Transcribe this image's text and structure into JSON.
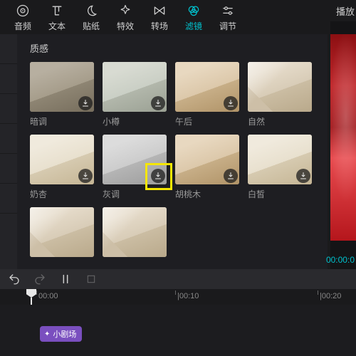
{
  "tabs": [
    {
      "id": "audio",
      "label": "音频"
    },
    {
      "id": "text",
      "label": "文本"
    },
    {
      "id": "sticker",
      "label": "贴纸"
    },
    {
      "id": "effect",
      "label": "特效"
    },
    {
      "id": "transition",
      "label": "转场"
    },
    {
      "id": "filter",
      "label": "滤镜",
      "active": true
    },
    {
      "id": "adjust",
      "label": "调节"
    }
  ],
  "section": {
    "title": "质感"
  },
  "filters": [
    {
      "id": "dark",
      "label": "暗调",
      "downloadable": true,
      "tone": "dark"
    },
    {
      "id": "xiaozun",
      "label": "小樽",
      "downloadable": true,
      "tone": "cool"
    },
    {
      "id": "wuhou",
      "label": "午后",
      "downloadable": true,
      "tone": "warm"
    },
    {
      "id": "ziran",
      "label": "自然",
      "downloadable": false,
      "tone": "default"
    },
    {
      "id": "naixing",
      "label": "奶杏",
      "downloadable": true,
      "tone": "bright"
    },
    {
      "id": "huidiao",
      "label": "灰调",
      "downloadable": true,
      "tone": "gray",
      "highlight": true
    },
    {
      "id": "hutaomu",
      "label": "胡桃木",
      "downloadable": true,
      "tone": "warm"
    },
    {
      "id": "baixi",
      "label": "白皙",
      "downloadable": true,
      "tone": "bright"
    },
    {
      "id": "extra1",
      "label": "",
      "downloadable": false,
      "tone": "default"
    },
    {
      "id": "extra2",
      "label": "",
      "downloadable": false,
      "tone": "default"
    }
  ],
  "preview": {
    "header": "播放",
    "time": "00:00:0"
  },
  "timeline": {
    "ticks": [
      {
        "label": "00:00",
        "pos": 0
      },
      {
        "label": "|00:10",
        "pos": 200
      },
      {
        "label": "|00:20",
        "pos": 400
      }
    ],
    "clip": {
      "label": "小剧场"
    }
  }
}
